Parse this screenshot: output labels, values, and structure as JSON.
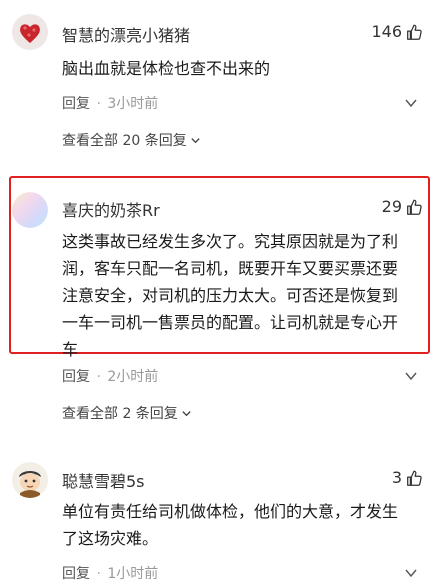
{
  "comments": [
    {
      "username": "智慧的漂亮小猪猪",
      "likes": "146",
      "lines": [
        "脑出血就是体检也查不出来的"
      ],
      "reply_label": "回复",
      "separator": "·",
      "time": "3小时前",
      "view_replies": "查看全部 20 条回复",
      "avatar_icon": "heart-avatar"
    },
    {
      "username": "喜庆的奶茶Rr",
      "likes": "29",
      "lines": [
        "这类事故已经发生多次了。究其原因就是为了利",
        "润，客车只配一名司机，既要开车又要买票还要",
        "注意安全，对司机的压力太大。可否还是恢复到",
        "一车一司机一售票员的配置。让司机就是专心开",
        "车"
      ],
      "reply_label": "回复",
      "separator": "·",
      "time": "2小时前",
      "view_replies": "查看全部 2 条回复",
      "avatar_icon": "gradient-avatar"
    },
    {
      "username": "聪慧雪碧5s",
      "likes": "3",
      "lines": [
        "单位有责任给司机做体检，他们的大意，才发生",
        "了这场灾难。"
      ],
      "reply_label": "回复",
      "separator": "·",
      "time": "1小时前",
      "avatar_icon": "character-avatar"
    }
  ],
  "colors": {
    "highlight_border": "#e0201f"
  }
}
